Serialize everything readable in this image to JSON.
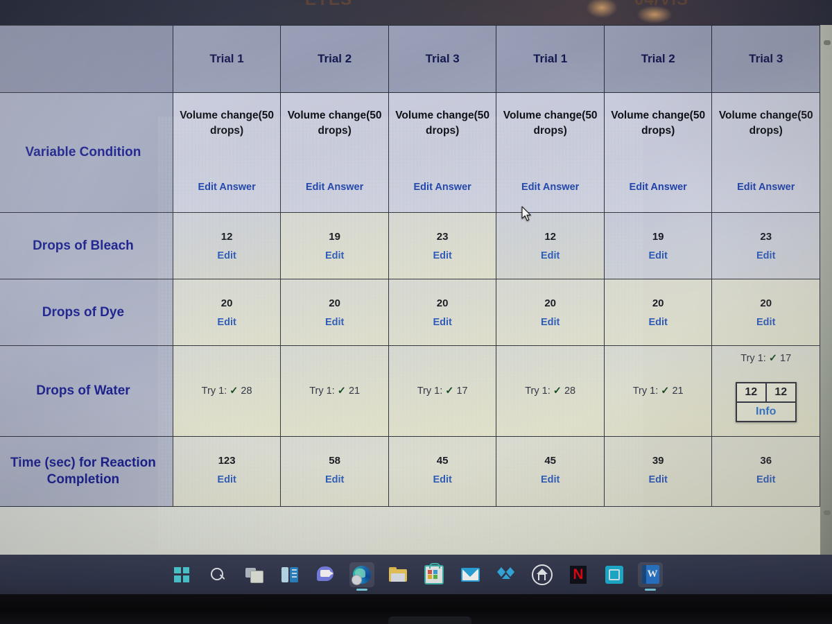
{
  "screen": {
    "glare_text_left": "EYES",
    "glare_text_right": "04/VIS"
  },
  "table": {
    "corner_label": "",
    "trial_headers": [
      "Trial 1",
      "Trial 2",
      "Trial 3",
      "Trial 1",
      "Trial 2",
      "Trial 3"
    ],
    "variable_condition": {
      "label": "Variable Condition",
      "question_line1": "Volume change(50",
      "question_line2": "drops)",
      "edit_answer_label": "Edit Answer",
      "cells": [
        "Volume change(50 drops)",
        "Volume change(50 drops)",
        "Volume change(50 drops)",
        "Volume change(50 drops)",
        "Volume change(50 drops)",
        "Volume change(50 drops)"
      ]
    },
    "rows": [
      {
        "label": "Drops of Bleach",
        "type": "value",
        "values": [
          "12",
          "19",
          "23",
          "12",
          "19",
          "23"
        ],
        "edit_label": "Edit"
      },
      {
        "label": "Drops of Dye",
        "type": "value",
        "values": [
          "20",
          "20",
          "20",
          "20",
          "20",
          "20"
        ],
        "edit_label": "Edit"
      },
      {
        "label": "Drops of Water",
        "type": "try",
        "try_prefix": "Try 1:",
        "check_glyph": "✓",
        "values": [
          "28",
          "21",
          "17",
          "28",
          "21",
          "17"
        ]
      },
      {
        "label": "Time (sec) for Reaction Completion",
        "label_line1": "Time (sec) for Reaction",
        "label_line2": "Completion",
        "type": "value",
        "values": [
          "123",
          "58",
          "45",
          "45",
          "39",
          "36"
        ],
        "edit_label": "Edit"
      }
    ],
    "popup": {
      "left_value": "12",
      "right_value": "12",
      "info_label": "Info"
    }
  },
  "taskbar": {
    "items": [
      {
        "name": "start-icon",
        "label": "Start"
      },
      {
        "name": "search-icon",
        "label": "Search"
      },
      {
        "name": "task-view-icon",
        "label": "Task View"
      },
      {
        "name": "widgets-icon",
        "label": "Widgets"
      },
      {
        "name": "teams-chat-icon",
        "label": "Chat"
      },
      {
        "name": "edge-browser-icon",
        "label": "Microsoft Edge"
      },
      {
        "name": "file-explorer-icon",
        "label": "File Explorer"
      },
      {
        "name": "microsoft-store-icon",
        "label": "Microsoft Store"
      },
      {
        "name": "mail-icon",
        "label": "Mail"
      },
      {
        "name": "dropbox-icon",
        "label": "Dropbox"
      },
      {
        "name": "house-app-icon",
        "label": "Home"
      },
      {
        "name": "netflix-icon",
        "label": "Netflix",
        "letter": "N"
      },
      {
        "name": "teal-app-icon",
        "label": "App"
      },
      {
        "name": "word-icon",
        "label": "Word",
        "letter": "W"
      }
    ]
  },
  "colors": {
    "link": "#2a56b5",
    "row_label": "#1a1f8c",
    "check": "#10421c",
    "taskbar_bg": "#343950",
    "edge_accent": "#1d9ad6"
  }
}
